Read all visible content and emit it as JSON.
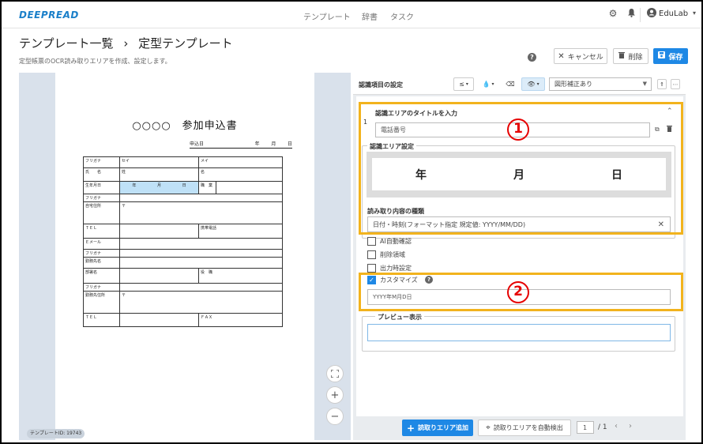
{
  "nav": {
    "logo": "DEEPREAD",
    "links": [
      "テンプレート",
      "辞書",
      "タスク"
    ],
    "user": "EduLab",
    "icons": [
      "gear-icon",
      "bell-icon",
      "user-circle-icon",
      "chevron-down-icon"
    ]
  },
  "header": {
    "breadcrumb_parent": "テンプレート一覧",
    "breadcrumb_sep": "›",
    "breadcrumb_current": "定型テンプレート",
    "description": "定型帳票のOCR読み取りエリアを作成、設定します。",
    "help": "?",
    "cancel_label": "キャンセル",
    "delete_label": "削除",
    "save_label": "保存"
  },
  "document": {
    "title": "○○○○　参加申込書",
    "date": [
      "申込日",
      "年",
      "月",
      "日"
    ],
    "rows": [
      [
        "フリガナ",
        "セイ",
        "",
        "メイ"
      ],
      [
        "氏　　名",
        "姓",
        "",
        "名"
      ],
      [
        "生年月日",
        "年",
        "月",
        "日",
        "職　業"
      ],
      [
        "フリガナ"
      ],
      [
        "自宅住所",
        "〒"
      ],
      [
        "ＴＥＬ",
        "携帯電話"
      ],
      [
        "Ｅメール"
      ],
      [
        "フリガナ"
      ],
      [
        "勤務先名"
      ],
      [
        "部署名",
        "役　職"
      ],
      [
        "フリガナ"
      ],
      [
        "勤務先住所",
        "〒"
      ],
      [
        "ＴＥＬ",
        "ＦＡＸ"
      ]
    ],
    "template_id": "テンプレートID: 19743"
  },
  "zoom": {
    "fit": "fit-icon",
    "in": "+",
    "out": "−"
  },
  "settings": {
    "title": "認識項目の設定",
    "tools": [
      "≤",
      "▾",
      "drop-icon",
      "▾",
      "eraser-icon",
      "eye-icon",
      "▾"
    ],
    "correction_select": "図形補正あり",
    "item_index": "1",
    "area_title_label": "認識エリアのタイトルを入力",
    "area_title_value": "電話番号",
    "area_setting_label": "認識エリア設定",
    "area_preview": [
      "年",
      "月",
      "日"
    ],
    "read_type_label": "読み取り内容の種類",
    "read_type_value": "日付・時刻(フォーマット指定 規定値: YYYY/MM/DD)",
    "checks": [
      {
        "label": "AI自動確認",
        "checked": false
      },
      {
        "label": "削除領域",
        "checked": false
      },
      {
        "label": "出力時設定",
        "checked": false
      },
      {
        "label": "カスタマイズ",
        "checked": true
      }
    ],
    "custom_value": "YYYY年M月D日",
    "preview_label": "プレビュー表示",
    "preview_value": ""
  },
  "annotations": {
    "one": "1",
    "two": "2"
  },
  "bottom": {
    "add_area": "読取りエリア追加",
    "auto_detect": "読取りエリアを自動検出",
    "page_current": "1",
    "page_total": "/ 1"
  },
  "colors": {
    "accent": "#1e88e5",
    "highlight": "#f2b31d",
    "marker": "#e60000"
  }
}
